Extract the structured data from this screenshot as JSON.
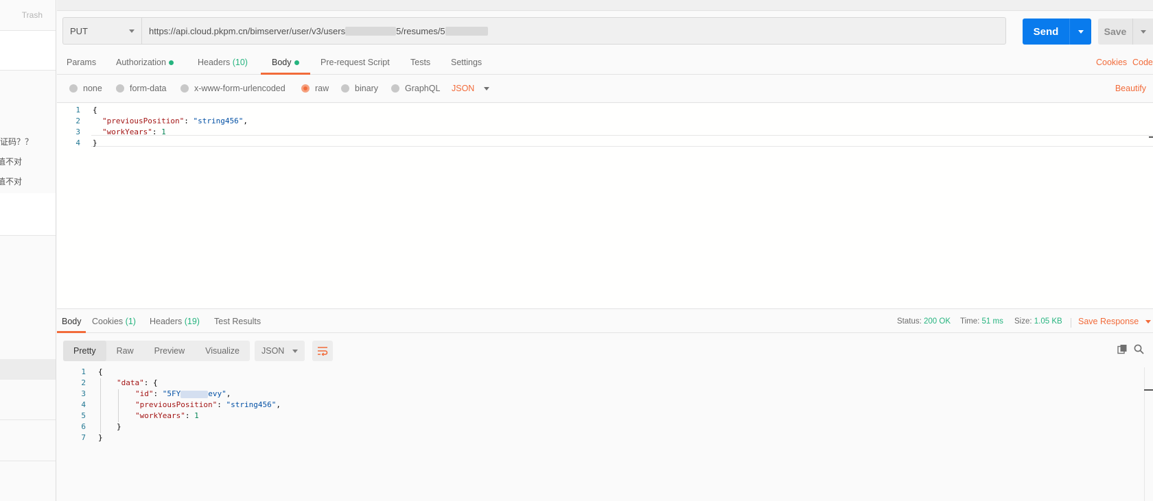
{
  "sidebar": {
    "trash_label": "Trash",
    "fragments": [
      "证码？？",
      "值不对",
      "值不对"
    ]
  },
  "request": {
    "method": "PUT",
    "url_parts": [
      "https://api.cloud.pkpm.cn/bimserver/user/v3/users",
      "5/resumes/5"
    ],
    "send_label": "Send",
    "save_label": "Save"
  },
  "tabs": {
    "params": "Params",
    "authorization": "Authorization",
    "headers": "Headers",
    "headers_count": "(10)",
    "body": "Body",
    "prerequest": "Pre-request Script",
    "tests": "Tests",
    "settings": "Settings",
    "cookies": "Cookies",
    "code": "Code"
  },
  "body_types": {
    "none": "none",
    "form_data": "form-data",
    "urlencoded": "x-www-form-urlencoded",
    "raw": "raw",
    "binary": "binary",
    "graphql": "GraphQL",
    "format": "JSON",
    "beautify": "Beautify",
    "selected": "raw"
  },
  "request_body": {
    "line_numbers": [
      "1",
      "2",
      "3",
      "4"
    ],
    "open_brace": "{",
    "close_brace": "}",
    "key1": "\"previousPosition\"",
    "val1": "\"string456\"",
    "key2": "\"workYears\"",
    "val2": "1"
  },
  "response": {
    "tabs": {
      "body": "Body",
      "cookies": "Cookies",
      "cookies_count": "(1)",
      "headers": "Headers",
      "headers_count": "(19)",
      "test_results": "Test Results"
    },
    "status_label": "Status:",
    "status_value": "200 OK",
    "time_label": "Time:",
    "time_value": "51 ms",
    "size_label": "Size:",
    "size_value": "1.05 KB",
    "save_response": "Save Response",
    "views": [
      "Pretty",
      "Raw",
      "Preview",
      "Visualize"
    ],
    "active_view": "Pretty",
    "format": "JSON",
    "line_numbers": [
      "1",
      "2",
      "3",
      "4",
      "5",
      "6",
      "7"
    ],
    "code": {
      "open": "{",
      "data_key": "\"data\"",
      "id_key": "\"id\"",
      "id_val_start": "\"5FY",
      "id_val_end": "evy\"",
      "prev_key": "\"previousPosition\"",
      "prev_val": "\"string456\"",
      "work_key": "\"workYears\"",
      "work_val": "1",
      "inner_close": "}",
      "close": "}"
    }
  },
  "colors": {
    "accent": "#f26b3a",
    "send": "#097bed",
    "success": "#26b47f"
  },
  "icons": [
    "chevron-down-icon",
    "wrap-lines-icon",
    "copy-icon",
    "search-icon"
  ]
}
